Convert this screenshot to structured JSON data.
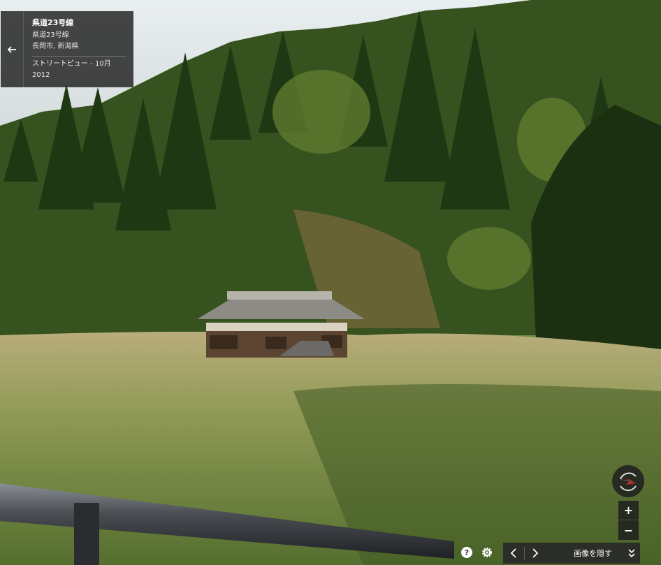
{
  "info_card": {
    "title": "県道23号線",
    "road": "県道23号線",
    "location": "長岡市, 新潟県",
    "capture": "ストリートビュー - 10月 2012"
  },
  "controls": {
    "zoom_in": "+",
    "zoom_out": "−"
  },
  "bottom_bar": {
    "hide_images": "画像を隠す"
  },
  "icons": {
    "back": "back-arrow-icon",
    "compass": "compass-icon",
    "help": "help-icon",
    "settings": "gear-icon",
    "prev": "chevron-left-icon",
    "next": "chevron-right-icon",
    "collapse": "double-chevron-down-icon"
  },
  "colors": {
    "panel_bg": "#282828",
    "compass_red": "#d22b2b"
  }
}
